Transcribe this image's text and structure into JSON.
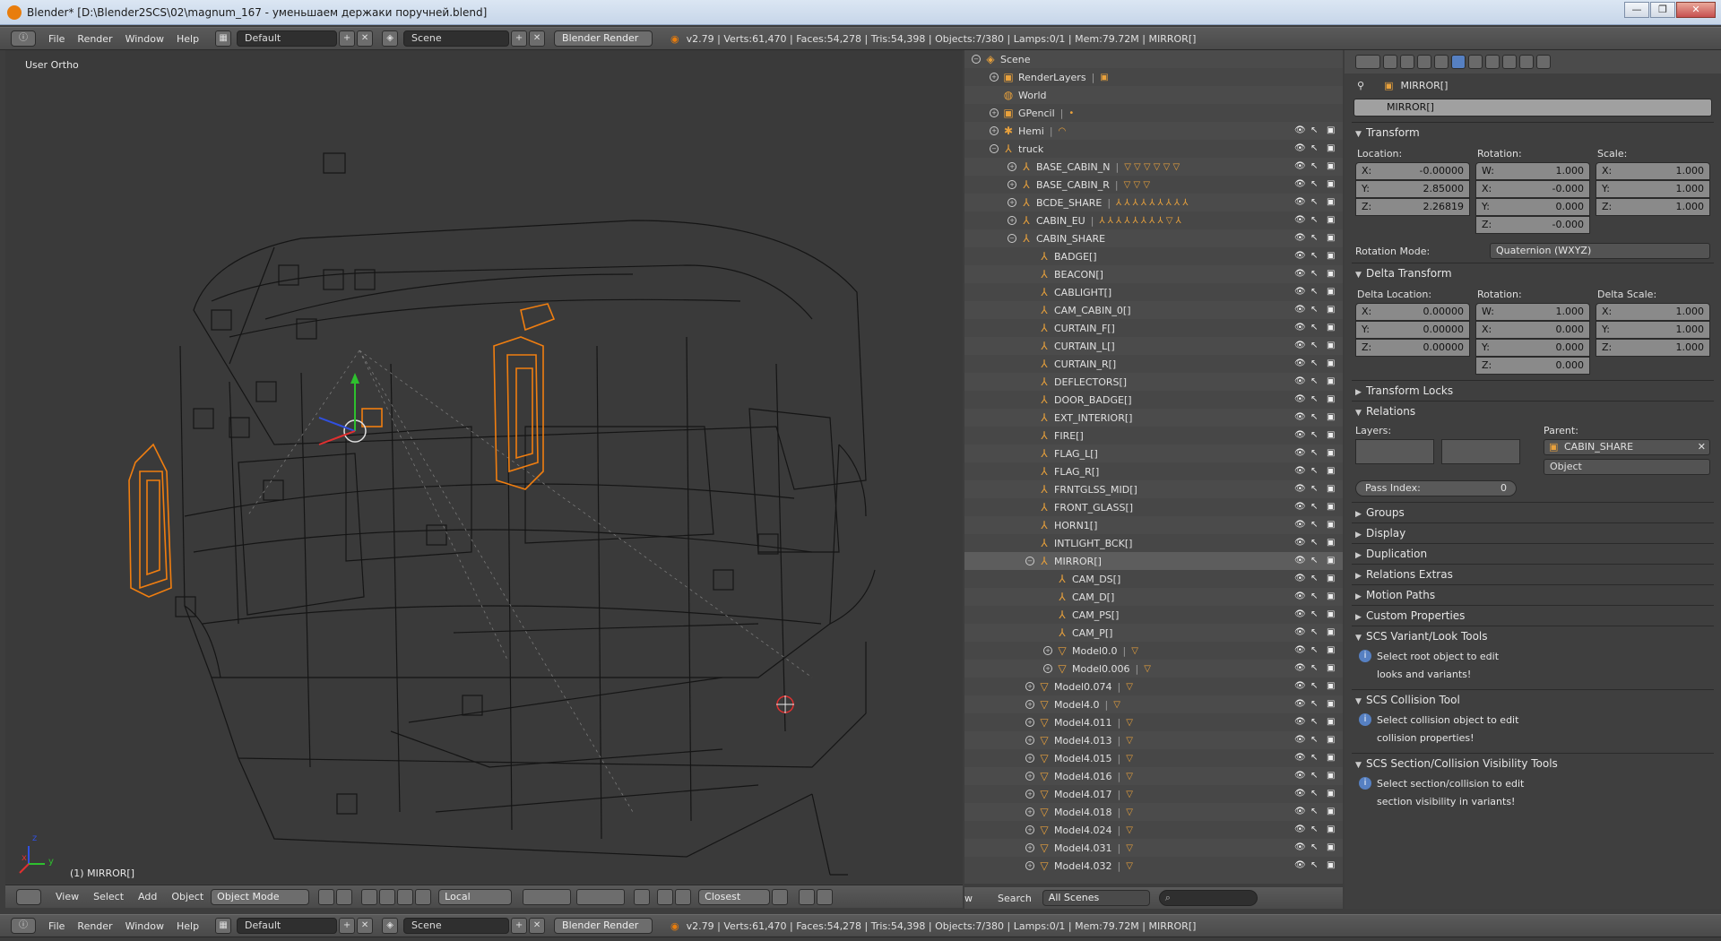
{
  "window": {
    "title": "Blender* [D:\\Blender2SCS\\02\\magnum_167 - уменьшаем держаки поручней.blend]",
    "buttons": [
      "—",
      "❐",
      "✕"
    ]
  },
  "info_header": {
    "menus": [
      "File",
      "Render",
      "Window",
      "Help"
    ],
    "layout": "Default",
    "scene": "Scene",
    "engine": "Blender Render",
    "stats": "v2.79 | Verts:61,470 | Faces:54,278 | Tris:54,398 | Objects:7/380 | Lamps:0/1 | Mem:79.72M | MIRROR[]"
  },
  "viewport": {
    "view_label": "User Ortho",
    "object_label": "(1) MIRROR[]",
    "axis_labels": {
      "x": "x",
      "y": "y",
      "z": "z"
    },
    "header": {
      "menus": [
        "View",
        "Select",
        "Add",
        "Object"
      ],
      "mode": "Object Mode",
      "orientation": "Local",
      "snap": "Closest"
    }
  },
  "outliner": {
    "rows": [
      {
        "indent": 0,
        "name": "Scene",
        "icon": "scene-icon",
        "exp": "−",
        "extra": ""
      },
      {
        "indent": 1,
        "name": "RenderLayers",
        "icon": "renderlayers-icon",
        "exp": "+",
        "extra": "▣"
      },
      {
        "indent": 1,
        "name": "World",
        "icon": "world-icon",
        "exp": "",
        "extra": ""
      },
      {
        "indent": 1,
        "name": "GPencil",
        "icon": "gpencil-icon",
        "exp": "+",
        "extra": "•"
      },
      {
        "indent": 1,
        "name": "Hemi",
        "icon": "lamp-icon",
        "exp": "+",
        "extra": "◠"
      },
      {
        "indent": 1,
        "name": "truck",
        "icon": "empty-icon",
        "exp": "−",
        "extra": ""
      },
      {
        "indent": 2,
        "name": "BASE_CABIN_N",
        "icon": "empty-icon",
        "exp": "+",
        "extra": "▽ ▽ ▽ ▽ ▽ ▽"
      },
      {
        "indent": 2,
        "name": "BASE_CABIN_R",
        "icon": "empty-icon",
        "exp": "+",
        "extra": "▽ ▽ ▽"
      },
      {
        "indent": 2,
        "name": "BCDE_SHARE",
        "icon": "empty-icon",
        "exp": "+",
        "extra": "⅄ ⅄ ⅄ ⅄ ⅄ ⅄ ⅄ ⅄ ⅄"
      },
      {
        "indent": 2,
        "name": "CABIN_EU",
        "icon": "empty-icon",
        "exp": "+",
        "extra": "⅄ ⅄ ⅄ ⅄ ⅄ ⅄ ⅄ ⅄ ▽ ⅄"
      },
      {
        "indent": 2,
        "name": "CABIN_SHARE",
        "icon": "empty-icon",
        "exp": "−",
        "extra": ""
      },
      {
        "indent": 3,
        "name": "BADGE[]",
        "icon": "empty-icon",
        "exp": "",
        "extra": ""
      },
      {
        "indent": 3,
        "name": "BEACON[]",
        "icon": "empty-icon",
        "exp": "",
        "extra": ""
      },
      {
        "indent": 3,
        "name": "CABLIGHT[]",
        "icon": "empty-icon",
        "exp": "",
        "extra": ""
      },
      {
        "indent": 3,
        "name": "CAM_CABIN_0[]",
        "icon": "empty-icon",
        "exp": "",
        "extra": ""
      },
      {
        "indent": 3,
        "name": "CURTAIN_F[]",
        "icon": "empty-icon",
        "exp": "",
        "extra": ""
      },
      {
        "indent": 3,
        "name": "CURTAIN_L[]",
        "icon": "empty-icon",
        "exp": "",
        "extra": ""
      },
      {
        "indent": 3,
        "name": "CURTAIN_R[]",
        "icon": "empty-icon",
        "exp": "",
        "extra": ""
      },
      {
        "indent": 3,
        "name": "DEFLECTORS[]",
        "icon": "empty-icon",
        "exp": "",
        "extra": ""
      },
      {
        "indent": 3,
        "name": "DOOR_BADGE[]",
        "icon": "empty-icon",
        "exp": "",
        "extra": ""
      },
      {
        "indent": 3,
        "name": "EXT_INTERIOR[]",
        "icon": "empty-icon",
        "exp": "",
        "extra": ""
      },
      {
        "indent": 3,
        "name": "FIRE[]",
        "icon": "empty-icon",
        "exp": "",
        "extra": ""
      },
      {
        "indent": 3,
        "name": "FLAG_L[]",
        "icon": "empty-icon",
        "exp": "",
        "extra": ""
      },
      {
        "indent": 3,
        "name": "FLAG_R[]",
        "icon": "empty-icon",
        "exp": "",
        "extra": ""
      },
      {
        "indent": 3,
        "name": "FRNTGLSS_MID[]",
        "icon": "empty-icon",
        "exp": "",
        "extra": ""
      },
      {
        "indent": 3,
        "name": "FRONT_GLASS[]",
        "icon": "empty-icon",
        "exp": "",
        "extra": ""
      },
      {
        "indent": 3,
        "name": "HORN1[]",
        "icon": "empty-icon",
        "exp": "",
        "extra": ""
      },
      {
        "indent": 3,
        "name": "INTLIGHT_BCK[]",
        "icon": "empty-icon",
        "exp": "",
        "extra": ""
      },
      {
        "indent": 3,
        "name": "MIRROR[]",
        "icon": "empty-icon",
        "exp": "−",
        "extra": "",
        "selected": true
      },
      {
        "indent": 4,
        "name": "CAM_DS[]",
        "icon": "empty-icon",
        "exp": "",
        "extra": ""
      },
      {
        "indent": 4,
        "name": "CAM_D[]",
        "icon": "empty-icon",
        "exp": "",
        "extra": ""
      },
      {
        "indent": 4,
        "name": "CAM_PS[]",
        "icon": "empty-icon",
        "exp": "",
        "extra": ""
      },
      {
        "indent": 4,
        "name": "CAM_P[]",
        "icon": "empty-icon",
        "exp": "",
        "extra": ""
      },
      {
        "indent": 4,
        "name": "Model0.0",
        "icon": "mesh-icon",
        "exp": "+",
        "extra": "▽"
      },
      {
        "indent": 4,
        "name": "Model0.006",
        "icon": "mesh-icon",
        "exp": "+",
        "extra": "▽"
      },
      {
        "indent": 3,
        "name": "Model0.074",
        "icon": "mesh-icon",
        "exp": "+",
        "extra": "▽"
      },
      {
        "indent": 3,
        "name": "Model4.0",
        "icon": "mesh-icon",
        "exp": "+",
        "extra": "▽"
      },
      {
        "indent": 3,
        "name": "Model4.011",
        "icon": "mesh-icon",
        "exp": "+",
        "extra": "▽"
      },
      {
        "indent": 3,
        "name": "Model4.013",
        "icon": "mesh-icon",
        "exp": "+",
        "extra": "▽"
      },
      {
        "indent": 3,
        "name": "Model4.015",
        "icon": "mesh-icon",
        "exp": "+",
        "extra": "▽"
      },
      {
        "indent": 3,
        "name": "Model4.016",
        "icon": "mesh-icon",
        "exp": "+",
        "extra": "▽"
      },
      {
        "indent": 3,
        "name": "Model4.017",
        "icon": "mesh-icon",
        "exp": "+",
        "extra": "▽"
      },
      {
        "indent": 3,
        "name": "Model4.018",
        "icon": "mesh-icon",
        "exp": "+",
        "extra": "▽"
      },
      {
        "indent": 3,
        "name": "Model4.024",
        "icon": "mesh-icon",
        "exp": "+",
        "extra": "▽"
      },
      {
        "indent": 3,
        "name": "Model4.031",
        "icon": "mesh-icon",
        "exp": "+",
        "extra": "▽"
      },
      {
        "indent": 3,
        "name": "Model4.032",
        "icon": "mesh-icon",
        "exp": "+",
        "extra": "▽"
      }
    ],
    "header": {
      "view_partial": "w",
      "search": "Search",
      "scope": "All Scenes"
    }
  },
  "properties": {
    "breadcrumb": "MIRROR[]",
    "object_name": "MIRROR[]",
    "transform": {
      "title": "Transform",
      "location_label": "Location:",
      "rotation_label": "Rotation:",
      "scale_label": "Scale:",
      "location": [
        {
          "k": "X:",
          "v": "-0.00000"
        },
        {
          "k": "Y:",
          "v": "2.85000"
        },
        {
          "k": "Z:",
          "v": "2.26819"
        }
      ],
      "rotation": [
        {
          "k": "W:",
          "v": "1.000"
        },
        {
          "k": "X:",
          "v": "-0.000"
        },
        {
          "k": "Y:",
          "v": "0.000"
        },
        {
          "k": "Z:",
          "v": "-0.000"
        }
      ],
      "scale": [
        {
          "k": "X:",
          "v": "1.000"
        },
        {
          "k": "Y:",
          "v": "1.000"
        },
        {
          "k": "Z:",
          "v": "1.000"
        }
      ],
      "rotation_mode_label": "Rotation Mode:",
      "rotation_mode": "Quaternion (WXYZ)"
    },
    "delta": {
      "title": "Delta Transform",
      "location_label": "Delta Location:",
      "rotation_label": "Rotation:",
      "scale_label": "Delta Scale:",
      "location": [
        {
          "k": "X:",
          "v": "0.00000"
        },
        {
          "k": "Y:",
          "v": "0.00000"
        },
        {
          "k": "Z:",
          "v": "0.00000"
        }
      ],
      "rotation": [
        {
          "k": "W:",
          "v": "1.000"
        },
        {
          "k": "X:",
          "v": "0.000"
        },
        {
          "k": "Y:",
          "v": "0.000"
        },
        {
          "k": "Z:",
          "v": "0.000"
        }
      ],
      "scale": [
        {
          "k": "X:",
          "v": "1.000"
        },
        {
          "k": "Y:",
          "v": "1.000"
        },
        {
          "k": "Z:",
          "v": "1.000"
        }
      ]
    },
    "transform_locks": "Transform Locks",
    "relations": {
      "title": "Relations",
      "layers_label": "Layers:",
      "parent_label": "Parent:",
      "parent": "CABIN_SHARE",
      "parent_type": "Object",
      "pass_index_label": "Pass Index:",
      "pass_index": "0"
    },
    "collapsed": [
      "Groups",
      "Display",
      "Duplication",
      "Relations Extras",
      "Motion Paths",
      "Custom Properties"
    ],
    "scs_variant": {
      "title": "SCS Variant/Look Tools",
      "line1": "Select root object to edit",
      "line2": "looks and variants!"
    },
    "scs_collision": {
      "title": "SCS Collision Tool",
      "line1": "Select collision object to edit",
      "line2": "collision properties!"
    },
    "scs_section": {
      "title": "SCS Section/Collision Visibility Tools",
      "line1": "Select section/collision to edit",
      "line2": "section visibility in variants!"
    }
  },
  "colors": {
    "selection": "#f07e10",
    "accent": "#5680c2",
    "background": "#3a3a3a"
  }
}
